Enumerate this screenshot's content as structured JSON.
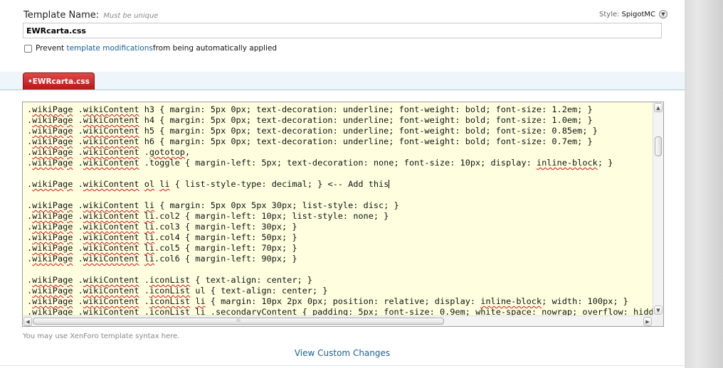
{
  "template_name": {
    "label": "Template Name:",
    "hint": "Must be unique",
    "value": "EWRcarta.css"
  },
  "style": {
    "label": "Style:",
    "value": "SpigotMC"
  },
  "prevent": {
    "text_before": "Prevent ",
    "link": "template modifications",
    "text_after": " from being automatically applied",
    "checked": false
  },
  "tabs": [
    {
      "label": "EWRcarta.css",
      "active": true
    }
  ],
  "editor": {
    "lines": [
      ".wikiPage .wikiContent h3 { margin: 5px 0px; text-decoration: underline; font-weight: bold; font-size: 1.2em; }",
      ".wikiPage .wikiContent h4 { margin: 5px 0px; text-decoration: underline; font-weight: bold; font-size: 1.0em; }",
      ".wikiPage .wikiContent h5 { margin: 5px 0px; text-decoration: underline; font-weight: bold; font-size: 0.85em; }",
      ".wikiPage .wikiContent h6 { margin: 5px 0px; text-decoration: underline; font-weight: bold; font-size: 0.7em; }",
      ".wikiPage .wikiContent .gototop,",
      ".wikiPage .wikiContent .toggle { margin-left: 5px; text-decoration: none; font-size: 10px; display: inline-block; }",
      "",
      ".wikiPage .wikiContent ol li { list-style-type: decimal; } <-- Add this",
      "",
      ".wikiPage .wikiContent li { margin: 5px 0px 5px 30px; list-style: disc; }",
      ".wikiPage .wikiContent li.col2 { margin-left: 10px; list-style: none; }",
      ".wikiPage .wikiContent li.col3 { margin-left: 30px; }",
      ".wikiPage .wikiContent li.col4 { margin-left: 50px; }",
      ".wikiPage .wikiContent li.col5 { margin-left: 70px; }",
      ".wikiPage .wikiContent li.col6 { margin-left: 90px; }",
      "",
      ".wikiPage .wikiContent .iconList { text-align: center; }",
      ".wikiPage .wikiContent .iconList ul { text-align: center; }",
      ".wikiPage .wikiContent .iconList li { margin: 10px 2px 0px; position: relative; display: inline-block; width: 100px; }",
      ".wikiPage .wikiContent .iconList li .secondaryContent { padding: 5px; font-size: 0.9em; white-space: nowrap; overflow: hidden; }"
    ],
    "caret_line": 7
  },
  "syntax_hint": "You may use XenForo template syntax here.",
  "view_custom_changes": "View Custom Changes",
  "icons": {
    "style_dropdown": "chevron-down-icon",
    "scroll_up": "arrow-up-icon",
    "scroll_down": "arrow-down-icon",
    "scroll_left": "arrow-left-icon",
    "scroll_right": "arrow-right-icon"
  }
}
